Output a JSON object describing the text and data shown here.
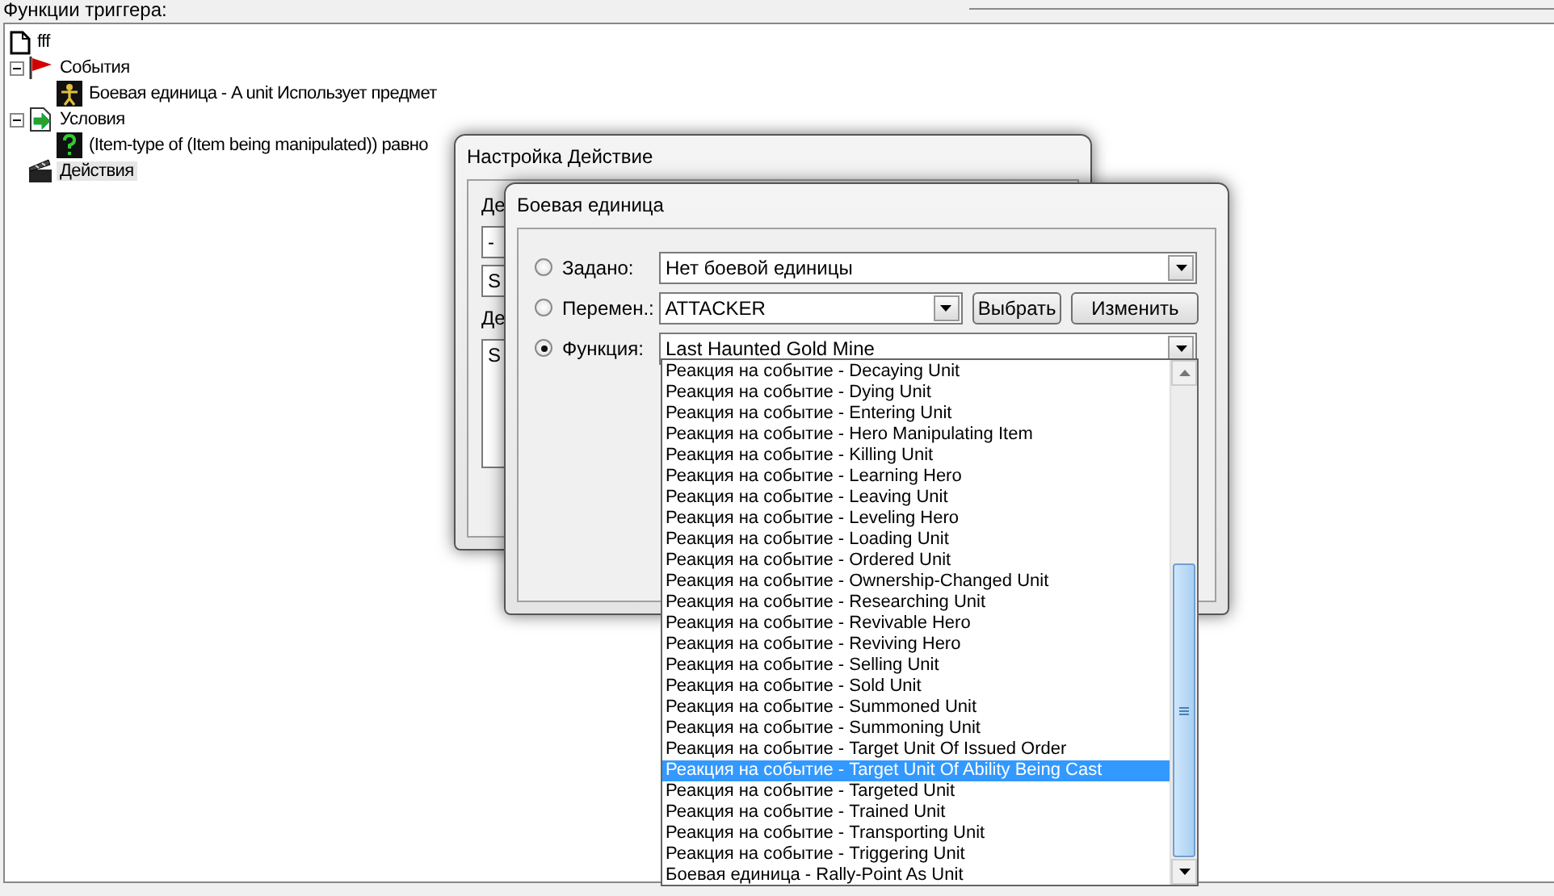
{
  "panel": {
    "title": "Функции триггера:"
  },
  "tree": {
    "label": "fff",
    "kind": "document",
    "selected": false,
    "children": [
      {
        "label": "События",
        "kind": "flag",
        "expanded": true,
        "selected": false,
        "children": [
          {
            "label": "Боевая единица - A unit Использует предмет",
            "kind": "unit",
            "selected": false
          }
        ]
      },
      {
        "label": "Условия",
        "kind": "condition",
        "expanded": true,
        "selected": false,
        "children": [
          {
            "label": "(Item-type of (Item being manipulated)) равно",
            "kind": "question",
            "selected": false
          }
        ]
      },
      {
        "label": "Действия",
        "kind": "clapper",
        "selected": true
      }
    ]
  },
  "back_dialog": {
    "title": "Настройка Действие",
    "fragments": [
      {
        "kind": "label",
        "text": "Де"
      },
      {
        "kind": "dropdown",
        "text": "-"
      },
      {
        "kind": "field",
        "text": "S"
      },
      {
        "kind": "label",
        "text": "Де"
      },
      {
        "kind": "textarea",
        "text": "S"
      }
    ]
  },
  "dialog": {
    "title": "Боевая единица",
    "options": [
      {
        "label": "Задано:",
        "selected": false,
        "value": "Нет боевой единицы"
      },
      {
        "label": "Перемен.:",
        "selected": false,
        "value": "ATTACKER",
        "buttons": [
          "Выбрать",
          "Изменить"
        ]
      },
      {
        "label": "Функция:",
        "selected": true,
        "value": "Last Haunted Gold Mine"
      }
    ]
  },
  "dropdown_list": {
    "items": [
      {
        "text": "Реакция на событие - Decaying Unit",
        "selected": false
      },
      {
        "text": "Реакция на событие - Dying Unit",
        "selected": false
      },
      {
        "text": "Реакция на событие - Entering Unit",
        "selected": false
      },
      {
        "text": "Реакция на событие - Hero Manipulating Item",
        "selected": false
      },
      {
        "text": "Реакция на событие - Killing Unit",
        "selected": false
      },
      {
        "text": "Реакция на событие - Learning Hero",
        "selected": false
      },
      {
        "text": "Реакция на событие - Leaving Unit",
        "selected": false
      },
      {
        "text": "Реакция на событие - Leveling Hero",
        "selected": false
      },
      {
        "text": "Реакция на событие - Loading Unit",
        "selected": false
      },
      {
        "text": "Реакция на событие - Ordered Unit",
        "selected": false
      },
      {
        "text": "Реакция на событие - Ownership-Changed Unit",
        "selected": false
      },
      {
        "text": "Реакция на событие - Researching Unit",
        "selected": false
      },
      {
        "text": "Реакция на событие - Revivable Hero",
        "selected": false
      },
      {
        "text": "Реакция на событие - Reviving Hero",
        "selected": false
      },
      {
        "text": "Реакция на событие - Selling Unit",
        "selected": false
      },
      {
        "text": "Реакция на событие - Sold Unit",
        "selected": false
      },
      {
        "text": "Реакция на событие - Summoned Unit",
        "selected": false
      },
      {
        "text": "Реакция на событие - Summoning Unit",
        "selected": false
      },
      {
        "text": "Реакция на событие - Target Unit Of Issued Order",
        "selected": false
      },
      {
        "text": "Реакция на событие - Target Unit Of Ability Being Cast",
        "selected": true
      },
      {
        "text": "Реакция на событие - Targeted Unit",
        "selected": false
      },
      {
        "text": "Реакция на событие - Trained Unit",
        "selected": false
      },
      {
        "text": "Реакция на событие - Transporting Unit",
        "selected": false
      },
      {
        "text": "Реакция на событие - Triggering Unit",
        "selected": false
      },
      {
        "text": "Боевая единица - Rally-Point As Unit",
        "selected": false
      }
    ]
  }
}
